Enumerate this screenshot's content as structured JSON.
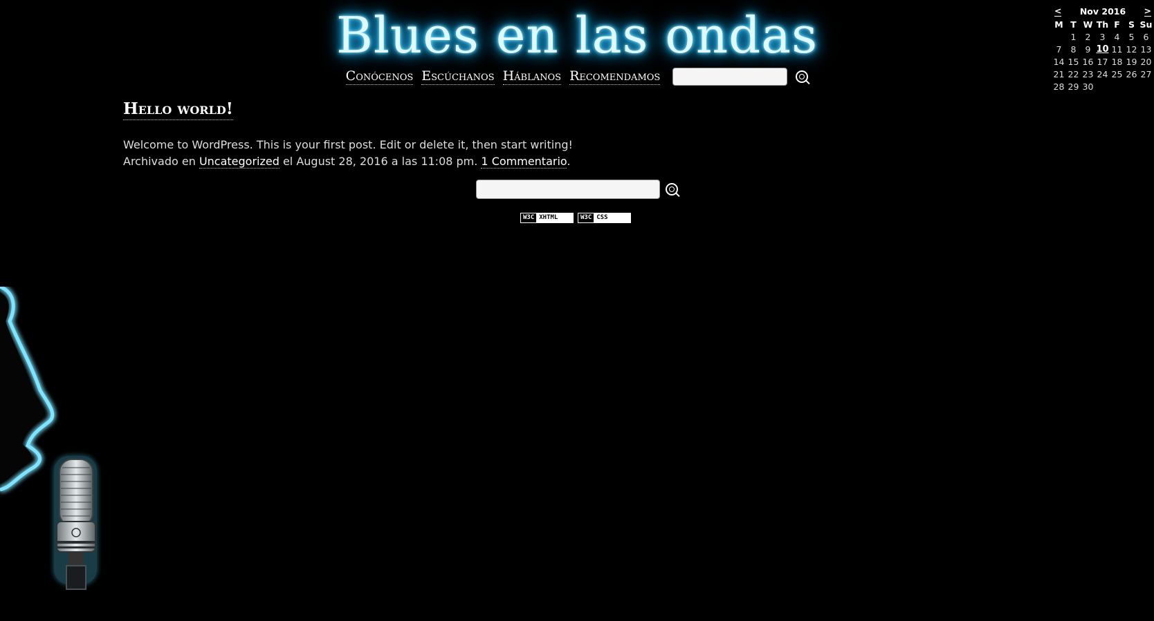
{
  "header": {
    "site_title": "Blues en las ondas",
    "nav": [
      {
        "label": "Conócenos"
      },
      {
        "label": "Escúchanos"
      },
      {
        "label": "Háblanos"
      },
      {
        "label": "Recomendamos"
      }
    ]
  },
  "post": {
    "title": "Hello world!",
    "body": "Welcome to WordPress. This is your first post. Edit or delete it, then start writing!",
    "meta_prefix": "Archivado en ",
    "category": "Uncategorized",
    "meta_middle": " el August 28, 2016 a las 11:08 pm. ",
    "comments_link": "1 Commentario",
    "meta_suffix": "."
  },
  "badges": [
    {
      "left": "W3C",
      "right": "XHTML"
    },
    {
      "left": "W3C",
      "right": "CSS"
    }
  ],
  "calendar": {
    "prev": "<",
    "next": ">",
    "month_label": "Nov 2016",
    "weekdays": [
      "M",
      "T",
      "W",
      "Th",
      "F",
      "S",
      "Su"
    ],
    "leading_blanks": 1,
    "days": [
      "1",
      "2",
      "3",
      "4",
      "5",
      "6",
      "7",
      "8",
      "9",
      "10",
      "11",
      "12",
      "13",
      "14",
      "15",
      "16",
      "17",
      "18",
      "19",
      "20",
      "21",
      "22",
      "23",
      "24",
      "25",
      "26",
      "27",
      "28",
      "29",
      "30"
    ],
    "today": "10"
  },
  "icons": {
    "search": "search-icon",
    "decoration": "singer-with-microphone"
  },
  "colors": {
    "background": "#000000",
    "glow": "#19b9ff"
  }
}
